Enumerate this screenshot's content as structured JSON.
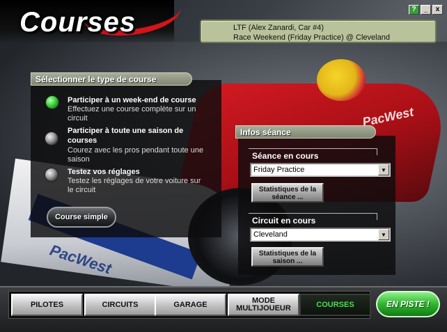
{
  "header": {
    "logo_text": "Courses",
    "status_line1": "LTF (Alex Zanardi, Car #4)",
    "status_line2": "Race Weekend (Friday Practice) @ Cleveland"
  },
  "window_buttons": {
    "help": "?",
    "minimize": "_",
    "close": "x"
  },
  "backdrop_text": {
    "sponsor_red": "PacWest",
    "sponsor_white": "PacWest"
  },
  "race_type": {
    "title": "Sélectionner le type de course",
    "options": [
      {
        "title": "Participer à un week-end de course",
        "description": "Effectuez une course complète sur un circuit",
        "selected": true
      },
      {
        "title": "Participer à toute une saison de courses",
        "description": "Courez avec les pros pendant toute une saison",
        "selected": false
      },
      {
        "title": "Testez vos réglages",
        "description": "Testez les réglages de votre voiture sur le circuit",
        "selected": false
      }
    ],
    "simple_button": "Course simple"
  },
  "session_info": {
    "title": "Infos séance",
    "current_session_label": "Séance en cours",
    "current_session_value": "Friday Practice",
    "session_stats_button": "Statistiques de la séance ...",
    "current_track_label": "Circuit en cours",
    "current_track_value": "Cleveland",
    "season_stats_button": "Statistiques de la saison ..."
  },
  "nav": {
    "tabs": [
      {
        "label": "PILOTES",
        "active": false
      },
      {
        "label": "CIRCUITS",
        "active": false
      },
      {
        "label": "GARAGE",
        "active": false
      },
      {
        "label": "MODE MULTIJOUEUR",
        "active": false
      },
      {
        "label": "COURSES",
        "active": true
      }
    ],
    "go_button": "EN PISTE !"
  },
  "colors": {
    "active_tab_text": "#44e04a",
    "go_button": "#2fb52f",
    "status_box": "#b9c29a",
    "car_red": "#d41a22"
  }
}
